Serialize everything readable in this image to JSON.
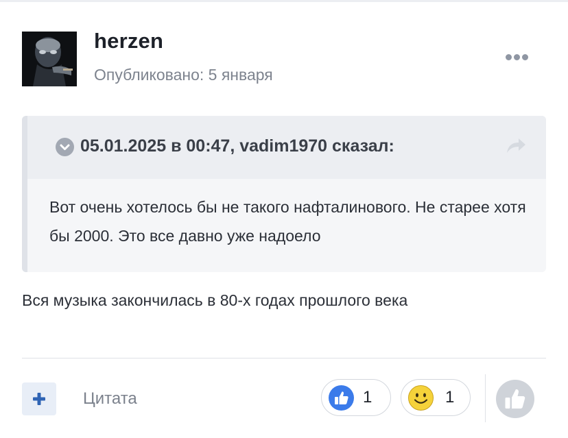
{
  "post": {
    "author": "herzen",
    "published": "Опубликовано: 5 января",
    "quote": {
      "citation": "05.01.2025 в 00:47, vadim1970 сказал:",
      "text": "Вот очень хотелось бы не такого нафталинового. Не старее хотя бы 2000. Это все давно уже надоело"
    },
    "body": "Вся музыка закончилась в 80-х годах прошлого века"
  },
  "footer": {
    "quote_label": "Цитата",
    "reactions": [
      {
        "icon": "thumbs-up-icon",
        "count": "1",
        "color": "#3b7bea"
      },
      {
        "icon": "smile-icon",
        "count": "1",
        "color": "#f5d23a"
      }
    ]
  },
  "icons": {
    "more": "more-dots-icon",
    "chevron": "chevron-down-icon",
    "share": "share-arrow-icon",
    "add": "plus-icon",
    "react": "thumbs-up-icon"
  },
  "colors": {
    "accent": "#3b7bea",
    "muted_text": "#7d838e",
    "quote_background": "#f5f6f8"
  }
}
